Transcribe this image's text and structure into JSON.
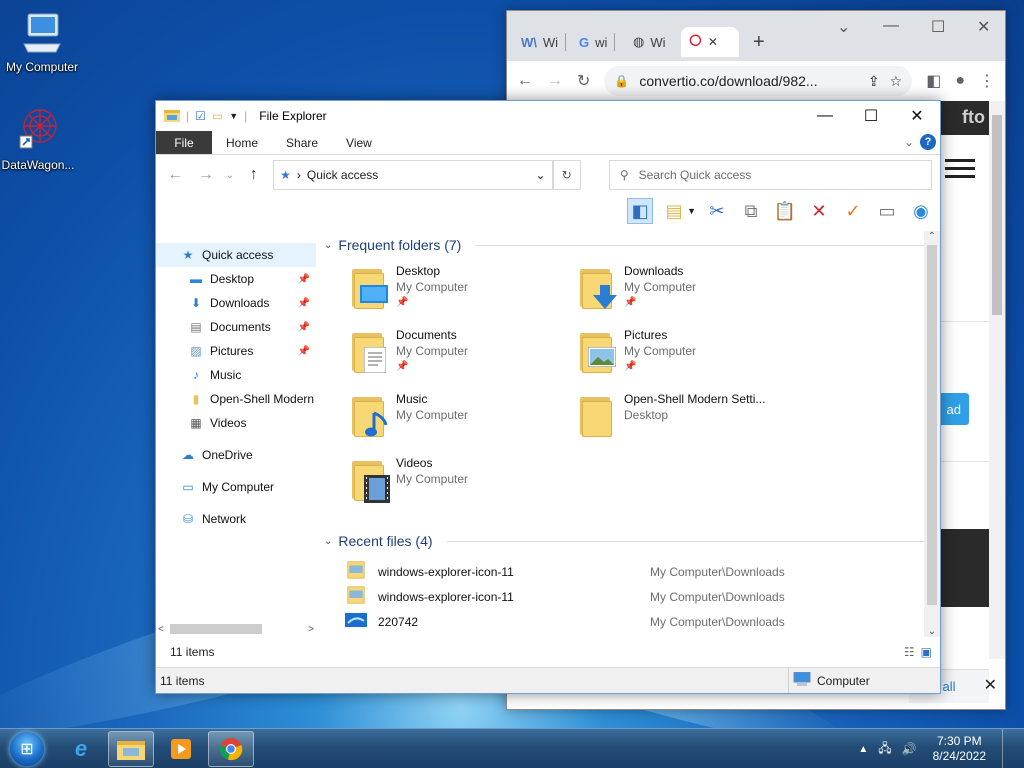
{
  "desktop": {
    "icons": [
      {
        "label": "My Computer",
        "icon": "computer-icon"
      },
      {
        "label": "DataWagon...",
        "icon": "datawagon-shortcut-icon"
      }
    ]
  },
  "chrome": {
    "tabs": [
      {
        "label": "Wi",
        "icon": "wikipedia-favicon"
      },
      {
        "label": "wi",
        "icon": "google-favicon"
      },
      {
        "label": "Wi",
        "icon": "globe-favicon"
      },
      {
        "label": "",
        "icon": "convertio-favicon",
        "close": "✕"
      }
    ],
    "new_tab": "+",
    "url": "convertio.co/download/982...",
    "page": {
      "brand_fragment": "fto",
      "button_fragment": "ad",
      "bottom_fragment": "all"
    }
  },
  "explorer": {
    "title": "File Explorer",
    "ribbon_tabs": [
      "File",
      "Home",
      "Share",
      "View"
    ],
    "address": "Quick access",
    "search_placeholder": "Search Quick access",
    "nav": [
      {
        "label": "Quick access",
        "icon": "star-icon",
        "pinned": false,
        "selected": true,
        "indent": 0
      },
      {
        "label": "Desktop",
        "icon": "desktop-icon",
        "pinned": true,
        "indent": 1
      },
      {
        "label": "Downloads",
        "icon": "download-arrow-icon",
        "pinned": true,
        "indent": 1
      },
      {
        "label": "Documents",
        "icon": "document-icon",
        "pinned": true,
        "indent": 1
      },
      {
        "label": "Pictures",
        "icon": "pictures-icon",
        "pinned": true,
        "indent": 1
      },
      {
        "label": "Music",
        "icon": "music-note-icon",
        "pinned": false,
        "indent": 1
      },
      {
        "label": "Open-Shell Modern",
        "icon": "folder-icon",
        "pinned": false,
        "indent": 1
      },
      {
        "label": "Videos",
        "icon": "film-icon",
        "pinned": false,
        "indent": 1
      },
      {
        "label": "OneDrive",
        "icon": "cloud-icon",
        "pinned": false,
        "indent": 0
      },
      {
        "label": "My Computer",
        "icon": "computer-icon",
        "pinned": false,
        "indent": 0
      },
      {
        "label": "Network",
        "icon": "network-icon",
        "pinned": false,
        "indent": 0
      }
    ],
    "frequent_header": "Frequent folders (7)",
    "frequent": [
      {
        "name": "Desktop",
        "location": "My Computer",
        "pinned": true,
        "overlay": "desktop"
      },
      {
        "name": "Downloads",
        "location": "My Computer",
        "pinned": true,
        "overlay": "download"
      },
      {
        "name": "Documents",
        "location": "My Computer",
        "pinned": true,
        "overlay": "document"
      },
      {
        "name": "Pictures",
        "location": "My Computer",
        "pinned": true,
        "overlay": "picture"
      },
      {
        "name": "Music",
        "location": "My Computer",
        "pinned": false,
        "overlay": "music"
      },
      {
        "name": "Open-Shell Modern Setti...",
        "location": "Desktop",
        "pinned": false,
        "overlay": "none"
      },
      {
        "name": "Videos",
        "location": "My Computer",
        "pinned": false,
        "overlay": "video"
      }
    ],
    "recent_header": "Recent files (4)",
    "recent": [
      {
        "name": "windows-explorer-icon-11",
        "path": "My Computer\\Downloads",
        "icon": "image-file-icon"
      },
      {
        "name": "windows-explorer-icon-11",
        "path": "My Computer\\Downloads",
        "icon": "image-file-icon"
      },
      {
        "name": "220742",
        "path": "My Computer\\Downloads",
        "icon": "wallpaper-file-icon"
      }
    ],
    "inner_status": "11 items",
    "outer_status": "11 items",
    "zone": "Computer"
  },
  "taskbar": {
    "apps": [
      "internet-explorer-icon",
      "file-explorer-icon",
      "media-player-icon",
      "chrome-icon"
    ],
    "time": "7:30 PM",
    "date": "8/24/2022"
  },
  "colors": {
    "accent": "#1a67c8",
    "folder": "#f7d874",
    "taskbar": "#234d77"
  }
}
